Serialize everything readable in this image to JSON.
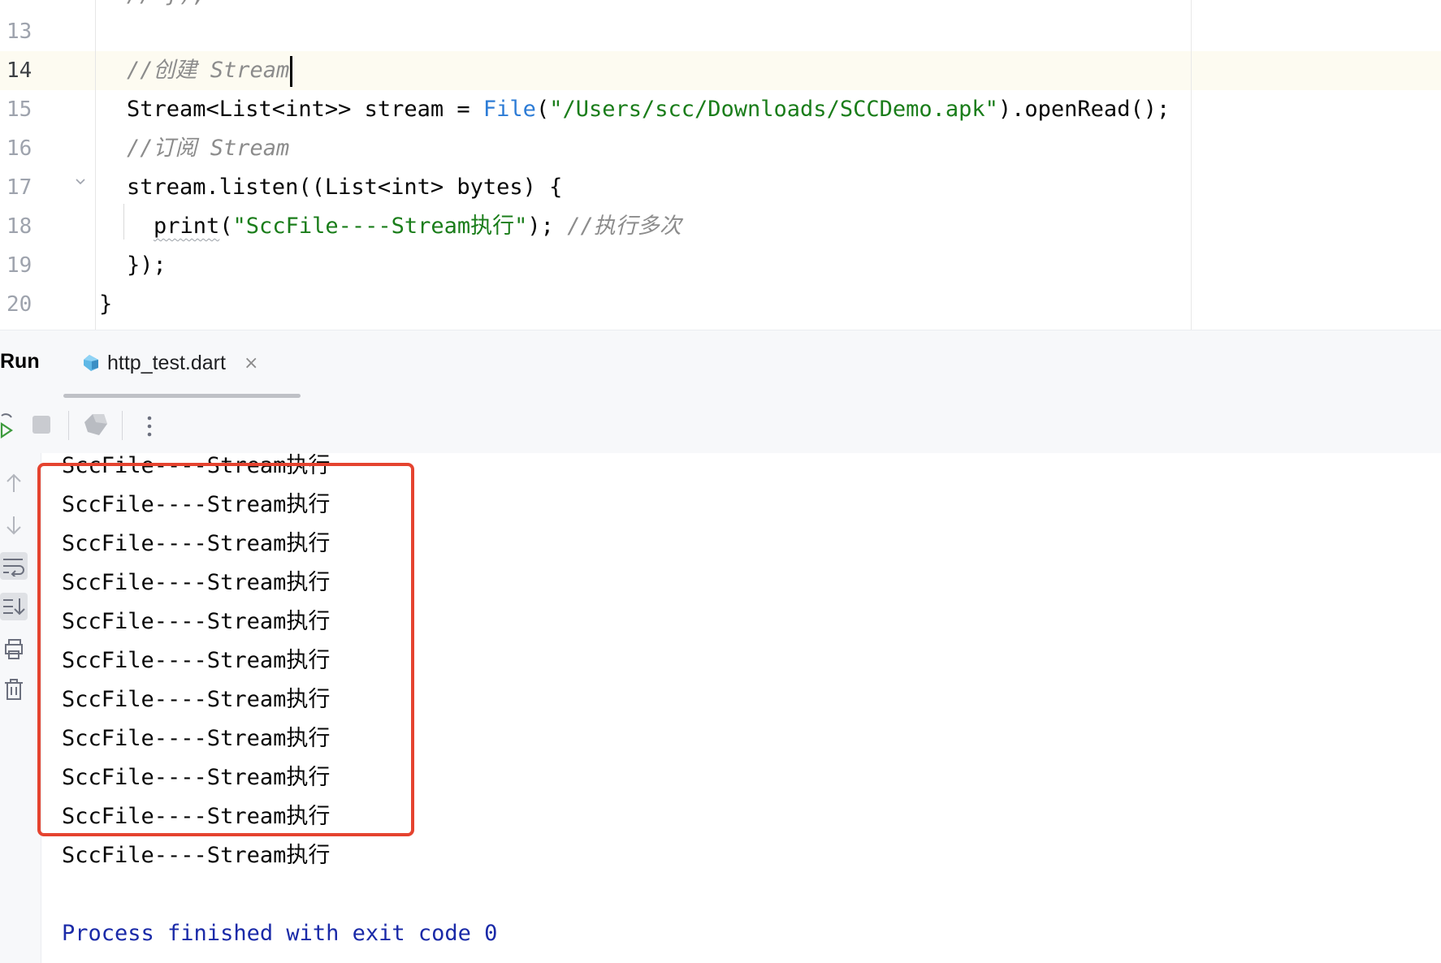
{
  "editor": {
    "top_fragment": "// });",
    "lines": [
      {
        "number": "13",
        "code": ""
      },
      {
        "number": "14",
        "code": "//创建 Stream",
        "current": true
      },
      {
        "number": "15",
        "code_parts": [
          "Stream<List<int>> stream = ",
          "File",
          "(",
          "\"/Users/scc/Downloads/SCCDemo.apk\"",
          ").openRead();"
        ]
      },
      {
        "number": "16",
        "code": "//订阅 Stream"
      },
      {
        "number": "17",
        "code": "stream.listen((List<int> bytes) {"
      },
      {
        "number": "18",
        "code_parts": [
          "print",
          "(",
          "\"SccFile----Stream执行\"",
          "); ",
          "//执行多次"
        ]
      },
      {
        "number": "19",
        "code": "});"
      },
      {
        "number": "20",
        "code": "}"
      }
    ]
  },
  "run_panel": {
    "title": "Run",
    "tab_label": "http_test.dart",
    "tab_close": "×"
  },
  "console": {
    "output_line": "SccFile----Stream执行",
    "outputs": [
      "SccFile----Stream执行",
      "SccFile----Stream执行",
      "SccFile----Stream执行",
      "SccFile----Stream执行",
      "SccFile----Stream执行",
      "SccFile----Stream执行",
      "SccFile----Stream执行",
      "SccFile----Stream执行",
      "SccFile----Stream执行",
      "SccFile----Stream执行",
      "SccFile----Stream执行"
    ],
    "process_message": "Process finished with exit code 0"
  },
  "colors": {
    "highlight_box": "#e5432f",
    "string": "#1a7d1a",
    "class": "#2d7cd6",
    "comment": "#8c8c8c",
    "process_text": "#1a2aa8"
  },
  "icons": {
    "toolbar": [
      "rerun-icon",
      "stop-icon",
      "dart-devtools-icon",
      "more-options-icon"
    ],
    "sidebar": [
      "scroll-up-icon",
      "scroll-down-icon",
      "soft-wrap-icon",
      "scroll-to-end-icon",
      "print-icon",
      "clear-all-icon"
    ]
  }
}
